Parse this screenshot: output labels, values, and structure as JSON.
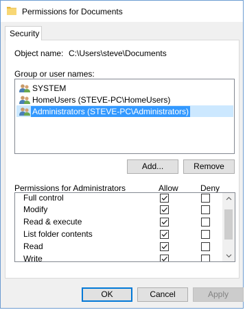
{
  "window": {
    "title": "Permissions for Documents"
  },
  "tabs": [
    {
      "label": "Security"
    }
  ],
  "object": {
    "label": "Object name:",
    "value": "C:\\Users\\steve\\Documents"
  },
  "groups": {
    "label": "Group or user names:",
    "items": [
      {
        "name": "SYSTEM",
        "selected": false
      },
      {
        "name": "HomeUsers (STEVE-PC\\HomeUsers)",
        "selected": false
      },
      {
        "name": "Administrators (STEVE-PC\\Administrators)",
        "selected": true
      }
    ]
  },
  "buttons": {
    "add": "Add...",
    "remove": "Remove",
    "ok": "OK",
    "cancel": "Cancel",
    "apply": "Apply"
  },
  "permissions": {
    "label": "Permissions for Administrators",
    "allow_header": "Allow",
    "deny_header": "Deny",
    "rows": [
      {
        "name": "Full control",
        "allow": true,
        "deny": false
      },
      {
        "name": "Modify",
        "allow": true,
        "deny": false
      },
      {
        "name": "Read & execute",
        "allow": true,
        "deny": false
      },
      {
        "name": "List folder contents",
        "allow": true,
        "deny": false
      },
      {
        "name": "Read",
        "allow": true,
        "deny": false
      },
      {
        "name": "Write",
        "allow": true,
        "deny": false
      }
    ]
  },
  "colors": {
    "selection": "#3399ff",
    "accent": "#0078d7"
  }
}
